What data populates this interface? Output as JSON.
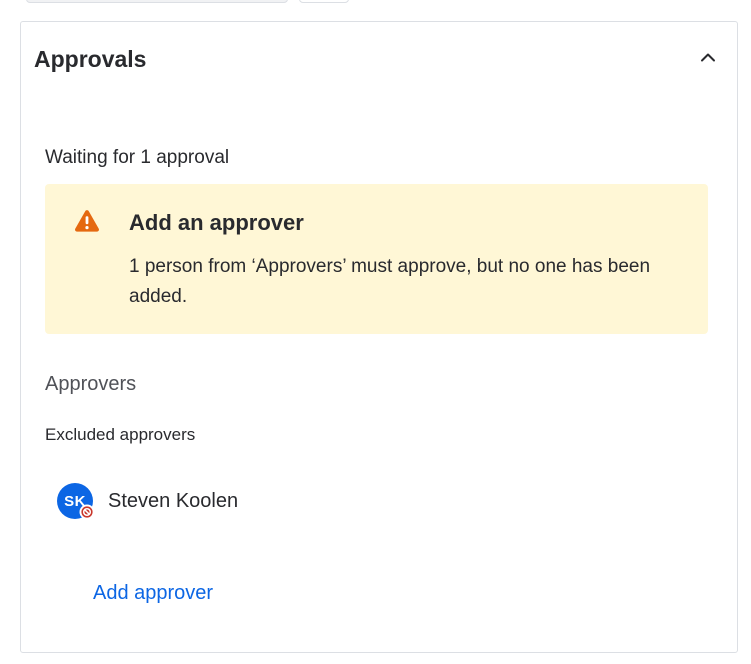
{
  "panel": {
    "title": "Approvals",
    "collapse_icon": "chevron-up-icon"
  },
  "status": {
    "waiting_text": "Waiting for 1 approval"
  },
  "warning": {
    "icon": "warning-icon",
    "title": "Add an approver",
    "body": "1 person from ‘Approvers’ must approve, but no one has been added.",
    "background_color": "#fff7d6",
    "icon_color": "#e56910"
  },
  "approvers": {
    "heading": "Approvers",
    "excluded_label": "Excluded approvers",
    "excluded": [
      {
        "initials": "SK",
        "name": "Steven Koolen",
        "avatar_color": "#0c66e4",
        "badge_icon": "blocked-icon",
        "badge_color": "#c9372c"
      }
    ],
    "add_label": "Add approver"
  },
  "colors": {
    "link": "#0c66e4",
    "text": "#292a2e",
    "subtle_text": "#505258",
    "border": "#dcdfe4"
  }
}
